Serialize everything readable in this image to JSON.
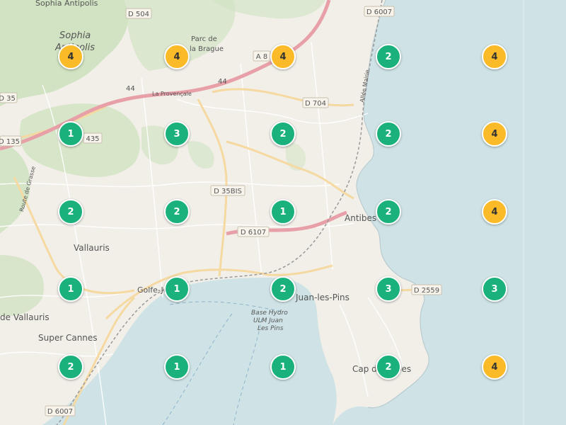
{
  "colors": {
    "land": "#f2efe9",
    "water": "#cfe3e6",
    "forest": "#cfe2c0",
    "motorway": "#e8a0a8",
    "road": "#f5d9a0",
    "cluster_green": "#1ab17d",
    "cluster_yellow": "#fbbb28"
  },
  "places": [
    {
      "name": "Sophia",
      "style": "italic"
    },
    {
      "name": "Antipolis",
      "style": "italic"
    },
    {
      "name": "Sophia Antipolis",
      "style": "normal"
    },
    {
      "name": "Parc de",
      "style": "forest"
    },
    {
      "name": "la Brague",
      "style": "forest"
    },
    {
      "name": "La Provençale",
      "style": "small"
    },
    {
      "name": "Vallauris",
      "style": "normal"
    },
    {
      "name": "Golfe-Juan",
      "style": "normal"
    },
    {
      "name": "Juan-les-Pins",
      "style": "normal"
    },
    {
      "name": "Antibes",
      "style": "normal"
    },
    {
      "name": "Super Cannes",
      "style": "normal"
    },
    {
      "name": "de Vallauris",
      "style": "normal"
    },
    {
      "name": "Cap d'Antibes",
      "style": "normal"
    },
    {
      "name": "Base Hydro",
      "style": "water"
    },
    {
      "name": "ULM Juan",
      "style": "water"
    },
    {
      "name": "Les Pins",
      "style": "water"
    },
    {
      "name": "Allée Mairie",
      "style": "small"
    },
    {
      "name": "Route de Grasse",
      "style": "small"
    }
  ],
  "roads": [
    "D 504",
    "D 6007",
    "A 8",
    "D 704",
    "D 35",
    "D 135",
    "435",
    "D 35BIS",
    "D 6107",
    "D 2559",
    "D 6007",
    "44",
    "44"
  ],
  "clusters": [
    {
      "count": "4",
      "color": "yellow"
    },
    {
      "count": "4",
      "color": "yellow"
    },
    {
      "count": "4",
      "color": "yellow"
    },
    {
      "count": "2",
      "color": "green"
    },
    {
      "count": "4",
      "color": "yellow"
    },
    {
      "count": "1",
      "color": "green"
    },
    {
      "count": "3",
      "color": "green"
    },
    {
      "count": "2",
      "color": "green"
    },
    {
      "count": "2",
      "color": "green"
    },
    {
      "count": "4",
      "color": "yellow"
    },
    {
      "count": "2",
      "color": "green"
    },
    {
      "count": "2",
      "color": "green"
    },
    {
      "count": "1",
      "color": "green"
    },
    {
      "count": "2",
      "color": "green"
    },
    {
      "count": "4",
      "color": "yellow"
    },
    {
      "count": "1",
      "color": "green"
    },
    {
      "count": "1",
      "color": "green"
    },
    {
      "count": "2",
      "color": "green"
    },
    {
      "count": "3",
      "color": "green"
    },
    {
      "count": "3",
      "color": "green"
    },
    {
      "count": "2",
      "color": "green"
    },
    {
      "count": "1",
      "color": "green"
    },
    {
      "count": "1",
      "color": "green"
    },
    {
      "count": "2",
      "color": "green"
    },
    {
      "count": "4",
      "color": "yellow"
    }
  ]
}
